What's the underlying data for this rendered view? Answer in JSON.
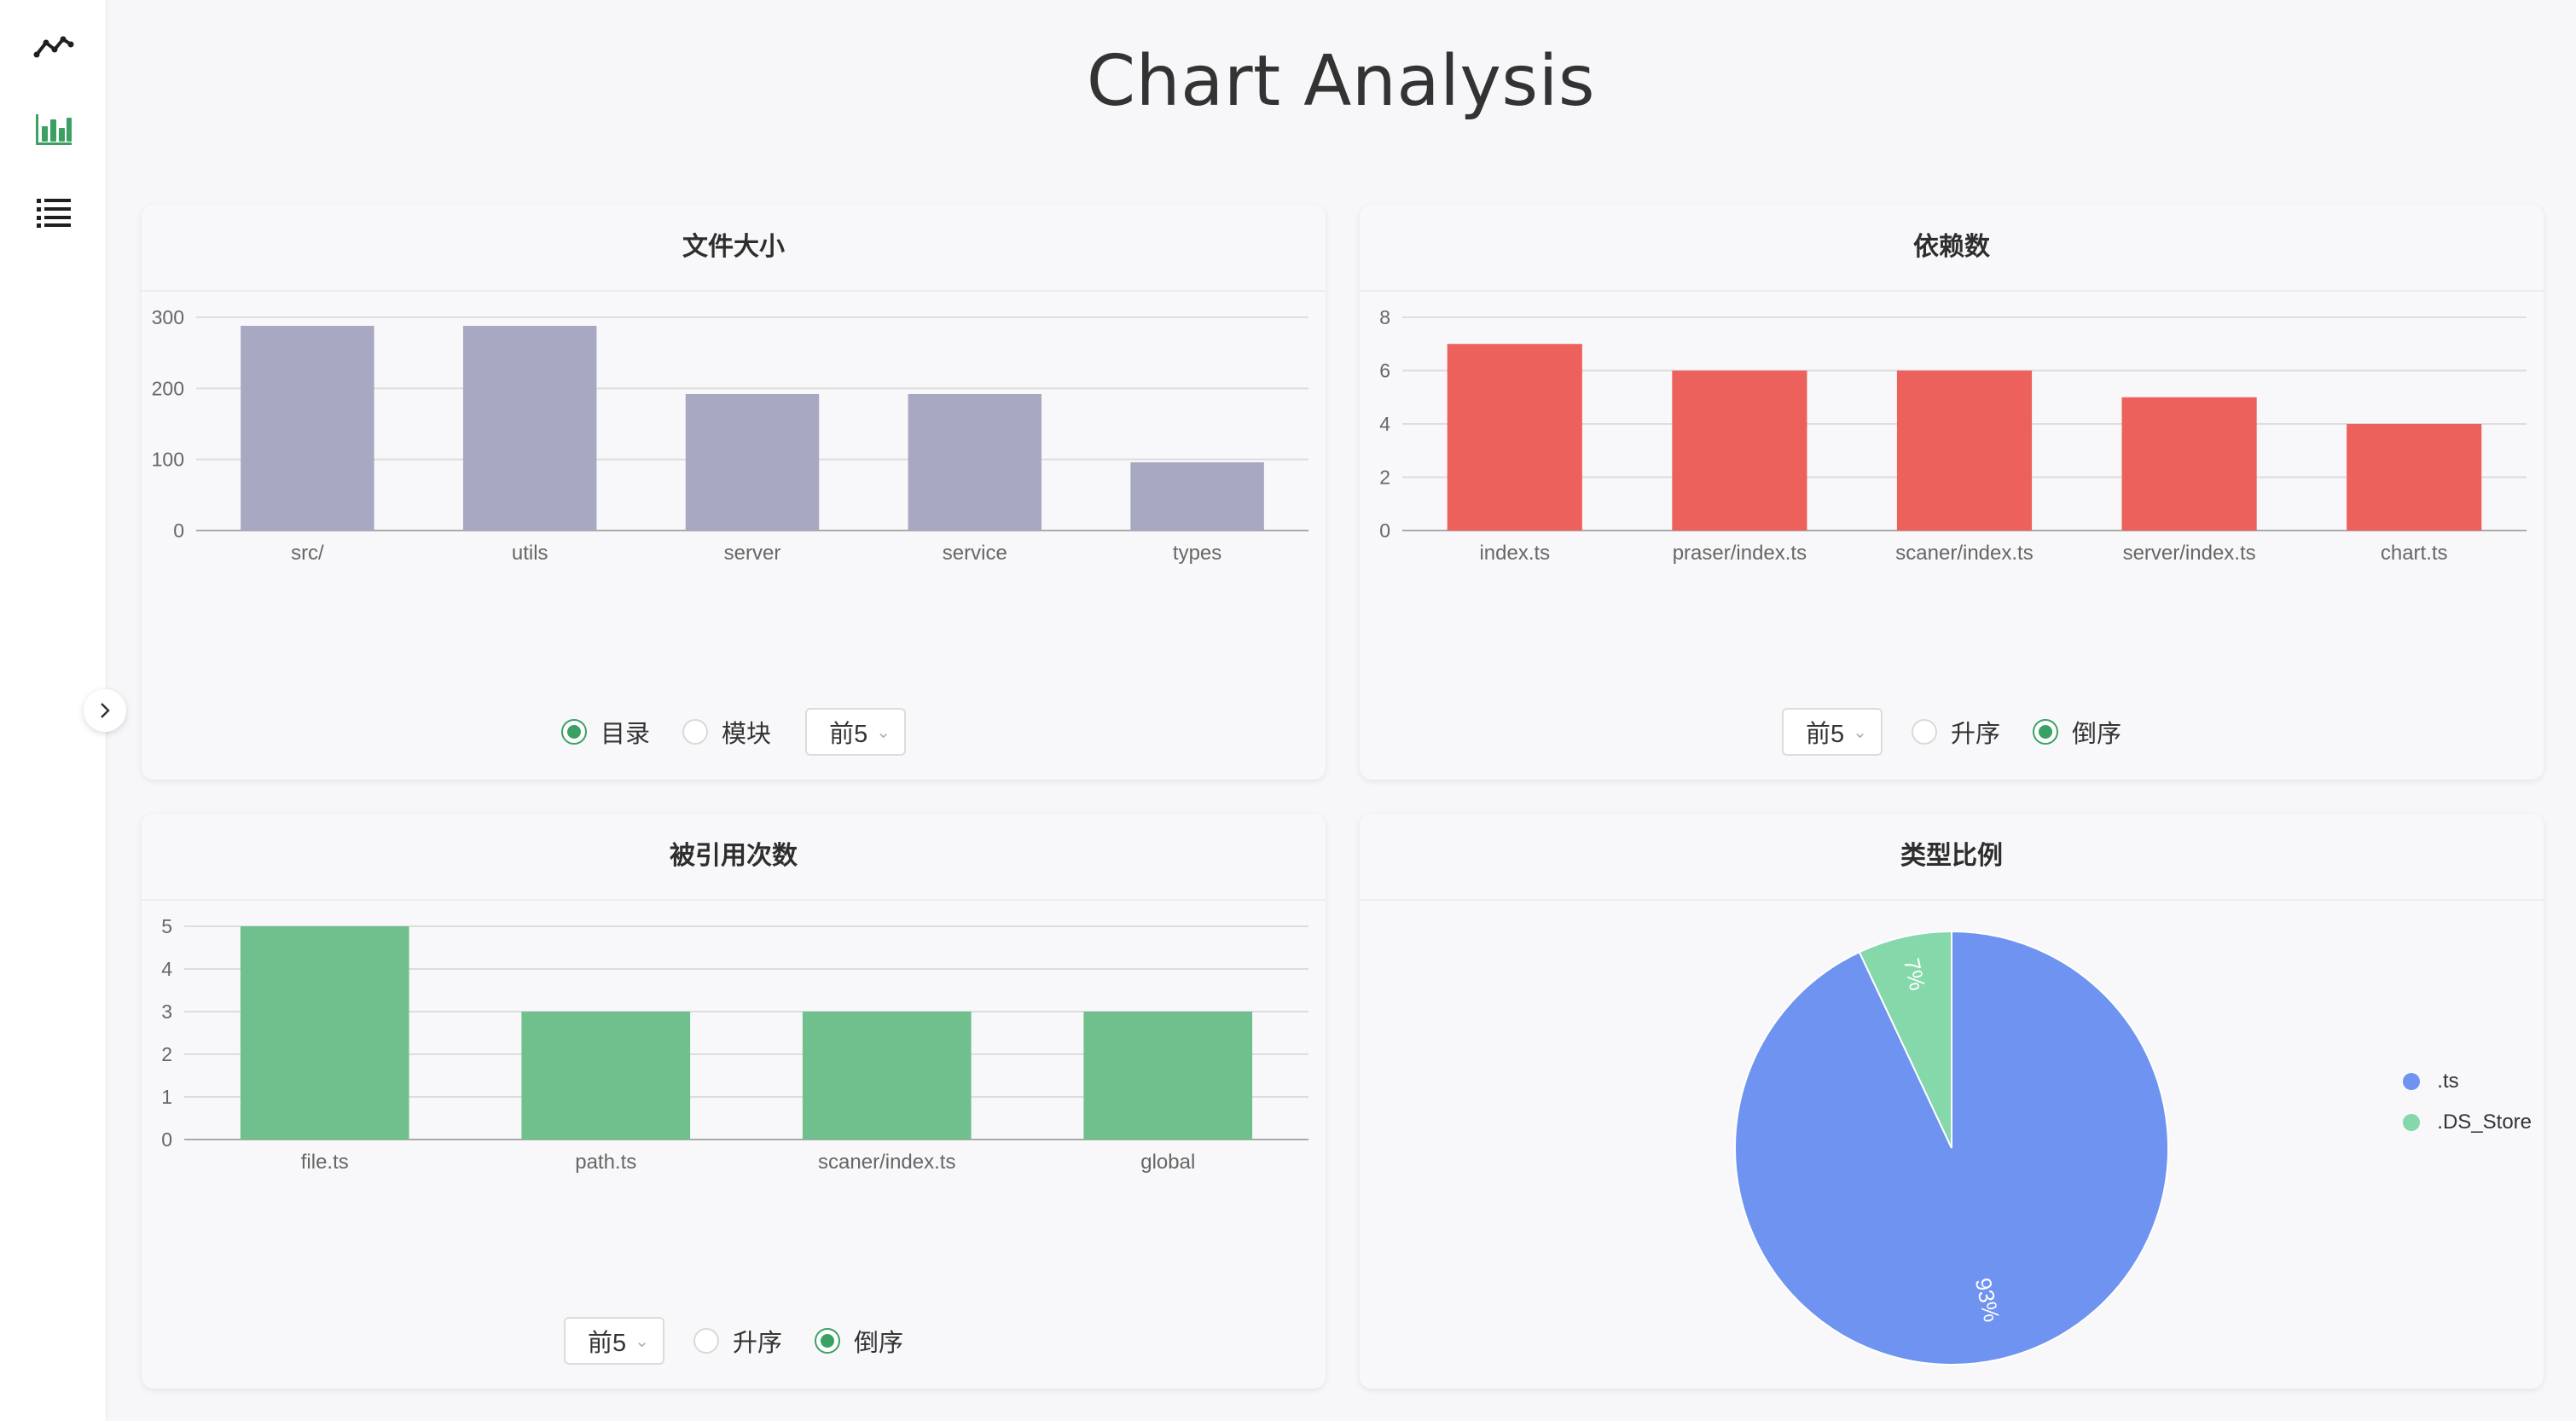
{
  "page": {
    "title": "Chart Analysis"
  },
  "sidebar": {
    "items": [
      {
        "icon": "line-chart-icon",
        "active": false
      },
      {
        "icon": "bar-chart-icon",
        "active": true
      },
      {
        "icon": "list-icon",
        "active": false
      }
    ],
    "collapse_icon": "chevron-right-icon"
  },
  "colors": {
    "file_size_bar": "#a9a8c3",
    "deps_bar": "#ec615b",
    "refs_bar": "#6fc08d",
    "pie_ts": "#6e93f0",
    "pie_ds": "#84d8aa",
    "radio_active": "#3aa163"
  },
  "cards": {
    "file_size": {
      "title": "文件大小",
      "radio_dir": "目录",
      "radio_module": "模块",
      "select_value": "前5",
      "selected_radio": "目录"
    },
    "deps": {
      "title": "依赖数",
      "select_value": "前5",
      "radio_asc": "升序",
      "radio_desc": "倒序",
      "selected_radio": "倒序"
    },
    "refs": {
      "title": "被引用次数",
      "select_value": "前5",
      "radio_asc": "升序",
      "radio_desc": "倒序",
      "selected_radio": "倒序"
    },
    "types": {
      "title": "类型比例"
    }
  },
  "chart_data": [
    {
      "type": "bar",
      "title": "文件大小",
      "categories": [
        "src/",
        "utils",
        "server",
        "service",
        "types"
      ],
      "values": [
        288,
        288,
        192,
        192,
        96
      ],
      "ylim": [
        0,
        300
      ],
      "yticks": [
        0,
        100,
        200,
        300
      ],
      "grid": true
    },
    {
      "type": "bar",
      "title": "依赖数",
      "categories": [
        "index.ts",
        "praser/index.ts",
        "scaner/index.ts",
        "server/index.ts",
        "chart.ts"
      ],
      "values": [
        7,
        6,
        6,
        5,
        4
      ],
      "ylim": [
        0,
        8
      ],
      "yticks": [
        0,
        2,
        4,
        6,
        8
      ],
      "grid": true
    },
    {
      "type": "bar",
      "title": "被引用次数",
      "categories": [
        "file.ts",
        "path.ts",
        "scaner/index.ts",
        "global"
      ],
      "values": [
        5,
        3,
        3,
        3
      ],
      "ylim": [
        0,
        5
      ],
      "yticks": [
        0,
        1,
        2,
        3,
        4,
        5
      ],
      "grid": true
    },
    {
      "type": "pie",
      "title": "类型比例",
      "slices": [
        {
          "label": ".ts",
          "value": 93,
          "text": "93%"
        },
        {
          "label": ".DS_Store",
          "value": 7,
          "text": "7%"
        }
      ],
      "legend": "right"
    }
  ]
}
